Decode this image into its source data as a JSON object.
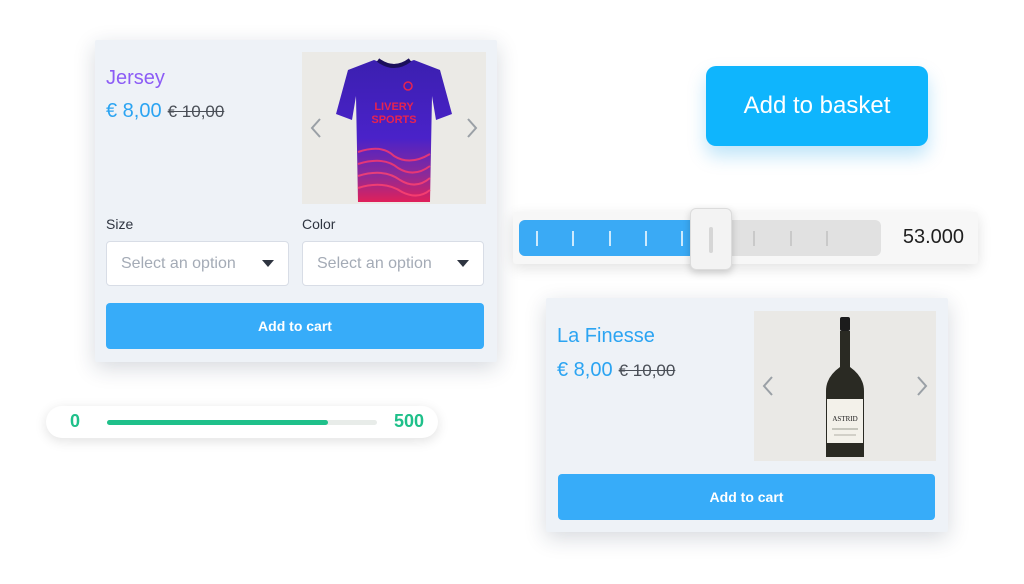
{
  "product_jersey": {
    "name": "Jersey",
    "price": "€ 8,00",
    "old_price": "€ 10,00",
    "shirt_text_line1": "LIVERY",
    "shirt_text_line2": "SPORTS",
    "size_label": "Size",
    "color_label": "Color",
    "size_placeholder": "Select an option",
    "color_placeholder": "Select an option",
    "cart_label": "Add to cart"
  },
  "product_wine": {
    "name": "La Finesse",
    "price": "€ 8,00",
    "old_price": "€ 10,00",
    "bottle_label": "ASTRID",
    "cart_label": "Add to cart"
  },
  "basket_button": {
    "label": "Add to basket"
  },
  "stepped_slider": {
    "value": 53000,
    "value_text": "53.000",
    "min": 0,
    "max": 100000,
    "steps": 10
  },
  "range_bar": {
    "min_label": "0",
    "max_label": "500",
    "min": 0,
    "max": 500,
    "value": 410
  },
  "colors": {
    "primary_blue": "#37acf9",
    "basket_blue": "#0fb5fd",
    "jersey_name": "#8c5cf6",
    "range_green": "#1fc08a",
    "card_bg": "#eef2f7"
  }
}
